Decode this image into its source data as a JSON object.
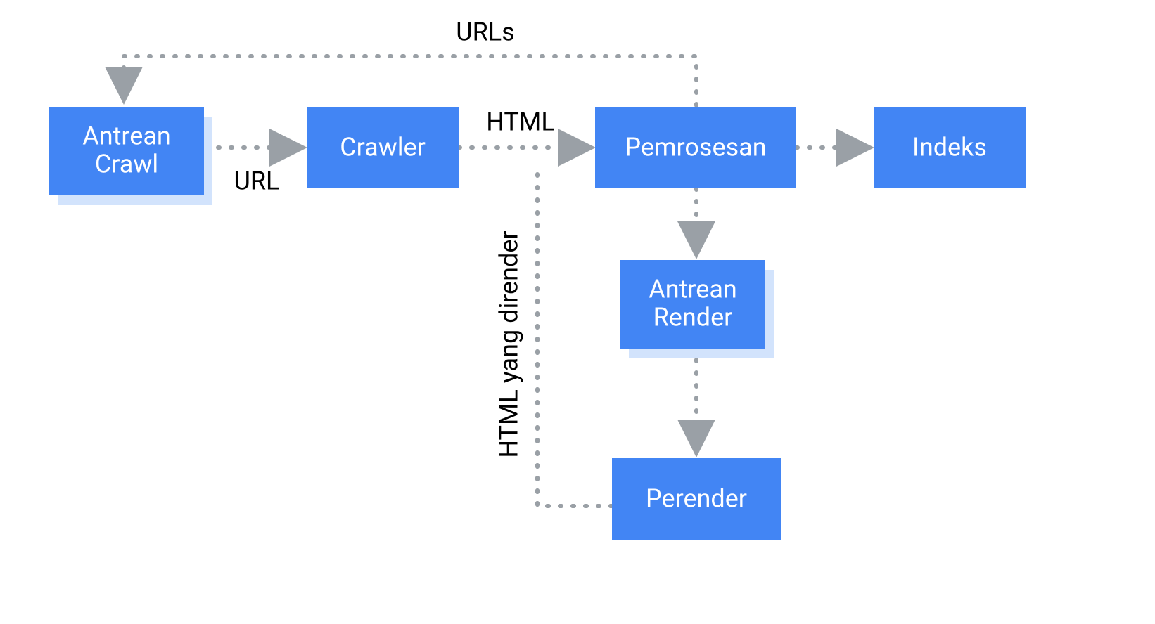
{
  "diagram": {
    "type": "flowchart",
    "palette": {
      "node_fill": "#4285F4",
      "node_shadow": "#D2E3FC",
      "node_text": "#FFFFFF",
      "connector": "#9AA0A6",
      "label_text": "#000000",
      "background": "#FFFFFF"
    },
    "nodes": {
      "crawl_queue": {
        "label_line1": "Antrean",
        "label_line2": "Crawl",
        "stacked": true
      },
      "crawler": {
        "label": "Crawler",
        "stacked": false
      },
      "processing": {
        "label": "Pemrosesan",
        "stacked": false
      },
      "index": {
        "label": "Indeks",
        "stacked": false
      },
      "render_queue": {
        "label_line1": "Antrean",
        "label_line2": "Render",
        "stacked": true
      },
      "renderer": {
        "label": "Perender",
        "stacked": false
      }
    },
    "edges": {
      "crawlq_to_crawler": {
        "from": "crawl_queue",
        "to": "crawler",
        "label": "URL"
      },
      "crawler_to_processing": {
        "from": "crawler",
        "to": "processing",
        "label": "HTML"
      },
      "processing_to_index": {
        "from": "processing",
        "to": "index",
        "label": ""
      },
      "processing_to_renderq": {
        "from": "processing",
        "to": "render_queue",
        "label": ""
      },
      "renderq_to_renderer": {
        "from": "render_queue",
        "to": "renderer",
        "label": ""
      },
      "renderer_to_processing": {
        "from": "renderer",
        "to": "processing",
        "label": "HTML yang dirender"
      },
      "processing_to_crawlq": {
        "from": "processing",
        "to": "crawl_queue",
        "label": "URLs"
      }
    }
  }
}
